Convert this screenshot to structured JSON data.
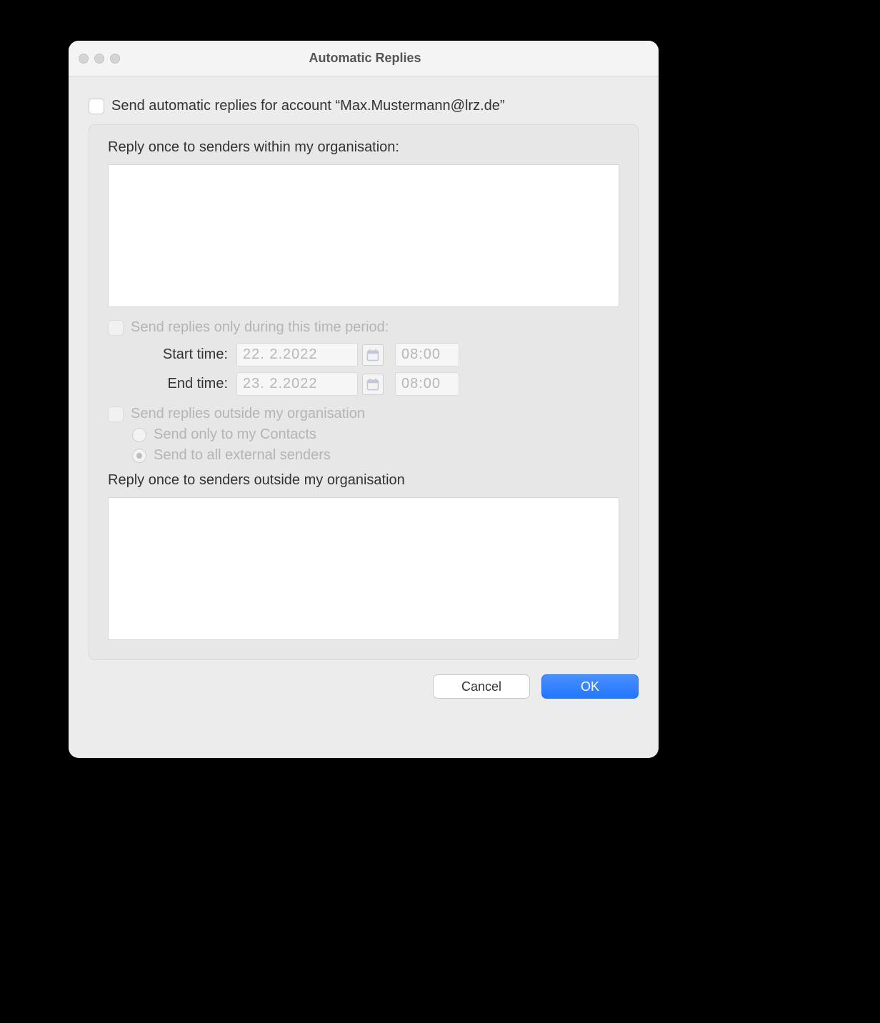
{
  "window": {
    "title": "Automatic Replies"
  },
  "main": {
    "enable_checkbox_label": "Send automatic replies for account “Max.Mustermann@lrz.de”",
    "internal_section_label": "Reply once to senders within my organisation:",
    "internal_reply_text": "",
    "time_period": {
      "checkbox_label": "Send replies only during this time period:",
      "start_label": "Start time:",
      "end_label": "End time:",
      "start_date": "22.  2.2022",
      "start_time": "08:00",
      "end_date": "23.  2.2022",
      "end_time": "08:00"
    },
    "external": {
      "checkbox_label": "Send replies outside my organisation",
      "radio_contacts_label": "Send only to my Contacts",
      "radio_all_label": "Send to all external senders",
      "section_label": "Reply once to senders outside my organisation",
      "reply_text": ""
    }
  },
  "buttons": {
    "cancel": "Cancel",
    "ok": "OK"
  }
}
